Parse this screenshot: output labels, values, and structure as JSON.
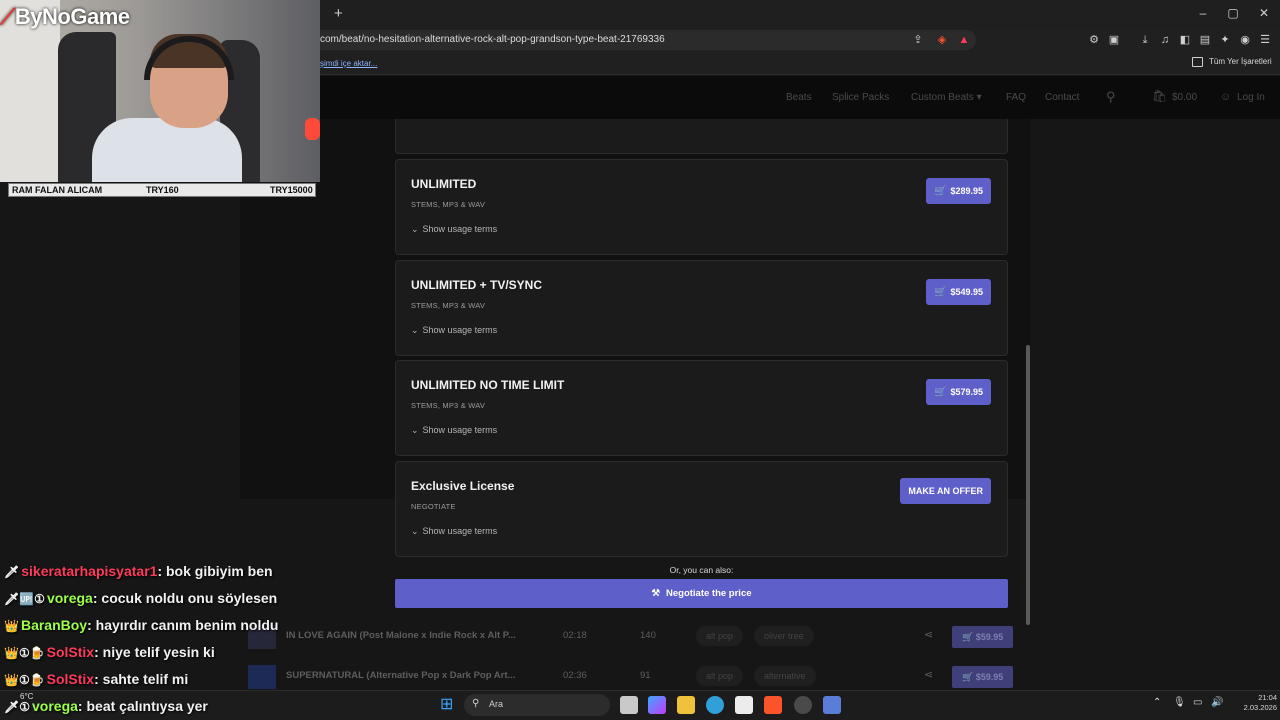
{
  "browser": {
    "new_tab_icon": "+",
    "url": "com/beat/no-hesitation-alternative-rock-alt-pop-grandson-type-beat-21769336",
    "import_link": "şimdi içe aktar...",
    "all_bookmarks": "Tüm Yer İşaretleri",
    "window_controls": [
      "–",
      "▢",
      "✕"
    ]
  },
  "site": {
    "nav": [
      "Beats",
      "Splice Packs",
      "Custom Beats ▾",
      "FAQ",
      "Contact"
    ],
    "cart_total": "$0.00",
    "login": "Log In"
  },
  "licenses": [
    {
      "title": "UNLIMITED",
      "formats": "STEMS, MP3 & WAV",
      "terms": "Show usage terms",
      "price": "$289.95"
    },
    {
      "title": "UNLIMITED + TV/SYNC",
      "formats": "STEMS, MP3 & WAV",
      "terms": "Show usage terms",
      "price": "$549.95"
    },
    {
      "title": "UNLIMITED NO TIME LIMIT",
      "formats": "STEMS, MP3 & WAV",
      "terms": "Show usage terms",
      "price": "$579.95"
    },
    {
      "title": "Exclusive License",
      "formats": "NEGOTIATE",
      "terms": "Show usage terms",
      "price": "MAKE AN OFFER"
    }
  ],
  "alt_text": "Or, you can also:",
  "negotiate_label": "Negotiate the price",
  "tracks": [
    {
      "title": "IN LOVE AGAIN (Post Malone x Indie Rock x Alt P...",
      "duration": "02:18",
      "bpm": "140",
      "tag1": "alt pop",
      "tag2": "oliver tree",
      "price": "$59.95"
    },
    {
      "title": "SUPERNATURAL (Alternative Pop x Dark Pop Art...",
      "duration": "02:36",
      "bpm": "91",
      "tag1": "alt pop",
      "tag2": "alternative",
      "price": "$59.95"
    }
  ],
  "taskbar": {
    "search_label": "Ara",
    "weather": "6°C",
    "time": "21:04",
    "date": "2.03.2026"
  },
  "overlay": {
    "logo": "ByNoGame",
    "stats": {
      "label": "RAM FALAN ALICAM",
      "current": "TRY160",
      "goal": "TRY15000"
    },
    "chat": [
      {
        "badges": "🗡",
        "user": "sikeratarhapisyatar1",
        "message": "bok gibiyim ben",
        "color": "#ff3b5c"
      },
      {
        "badges": "🗡🆙①",
        "user": "vorega",
        "message": "cocuk noldu onu söylesen",
        "color": "#9dff4a"
      },
      {
        "badges": "👑",
        "user": "BaranBoy",
        "message": "hayırdır canım benim noldu",
        "color": "#9dff4a"
      },
      {
        "badges": "👑①🍺",
        "user": "SolStix",
        "message": "niye telif yesin ki",
        "color": "#ff3b5c"
      },
      {
        "badges": "👑①🍺",
        "user": "SolStix",
        "message": "sahte telif mi",
        "color": "#ff3b5c"
      },
      {
        "badges": "🗡①",
        "user": "vorega",
        "message": "beat çalıntıysa yer",
        "color": "#9dff4a"
      }
    ]
  }
}
